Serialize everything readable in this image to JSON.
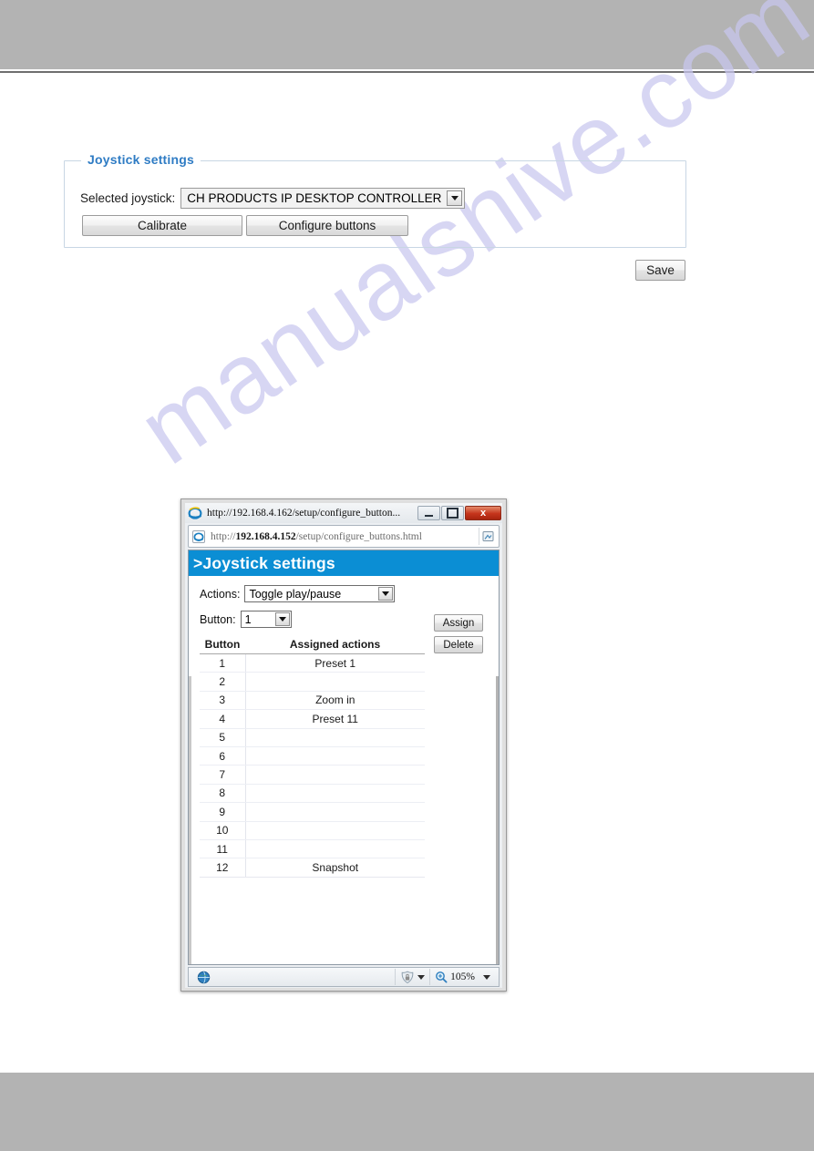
{
  "watermark": {
    "text": "manualshive.com"
  },
  "joystick_settings": {
    "legend": "Joystick settings",
    "selected_joystick_label": "Selected joystick:",
    "selected_joystick_value": "CH PRODUCTS IP DESKTOP CONTROLLER",
    "calibrate_label": "Calibrate",
    "configure_buttons_label": "Configure buttons",
    "dropdown_icon": "chevron-down-icon"
  },
  "save": {
    "label": "Save"
  },
  "popup": {
    "title": "http://192.168.4.162/setup/configure_button...",
    "browser_icon": "internet-explorer-icon",
    "window_controls": {
      "minimize": "minimize-icon",
      "maximize": "maximize-icon",
      "close": "x"
    },
    "address": {
      "icon": "internet-explorer-icon",
      "scheme": "http://",
      "host": "192.168.4.152",
      "path": "/setup/configure_buttons.html",
      "full": "http://192.168.4.152/setup/configure_buttons.html",
      "right_icon": "rss-feed-icon"
    },
    "page_header": ">Joystick settings",
    "form": {
      "actions_label": "Actions:",
      "actions_value": "Toggle play/pause",
      "button_label": "Button:",
      "button_value": "1",
      "assign_label": "Assign",
      "delete_label": "Delete"
    },
    "table": {
      "headers": [
        "Button",
        "Assigned actions"
      ],
      "rows": [
        {
          "button": "1",
          "action": "Preset 1"
        },
        {
          "button": "2",
          "action": ""
        },
        {
          "button": "3",
          "action": "Zoom in"
        },
        {
          "button": "4",
          "action": "Preset 11"
        },
        {
          "button": "5",
          "action": ""
        },
        {
          "button": "6",
          "action": ""
        },
        {
          "button": "7",
          "action": ""
        },
        {
          "button": "8",
          "action": ""
        },
        {
          "button": "9",
          "action": ""
        },
        {
          "button": "10",
          "action": ""
        },
        {
          "button": "11",
          "action": ""
        },
        {
          "button": "12",
          "action": "Snapshot"
        }
      ]
    },
    "statusbar": {
      "globe_icon": "internet-zone-globe-icon",
      "security_icon": "protected-mode-shield-icon",
      "zoom_icon": "zoom-magnifier-icon",
      "zoom_level": "105%"
    }
  },
  "colors": {
    "band": "#b3b3b3",
    "legend_blue": "#2f7cc4",
    "popup_header_blue": "#0b8ed4",
    "watermark": "#c9c7ef",
    "close_red": "#c5341b"
  }
}
